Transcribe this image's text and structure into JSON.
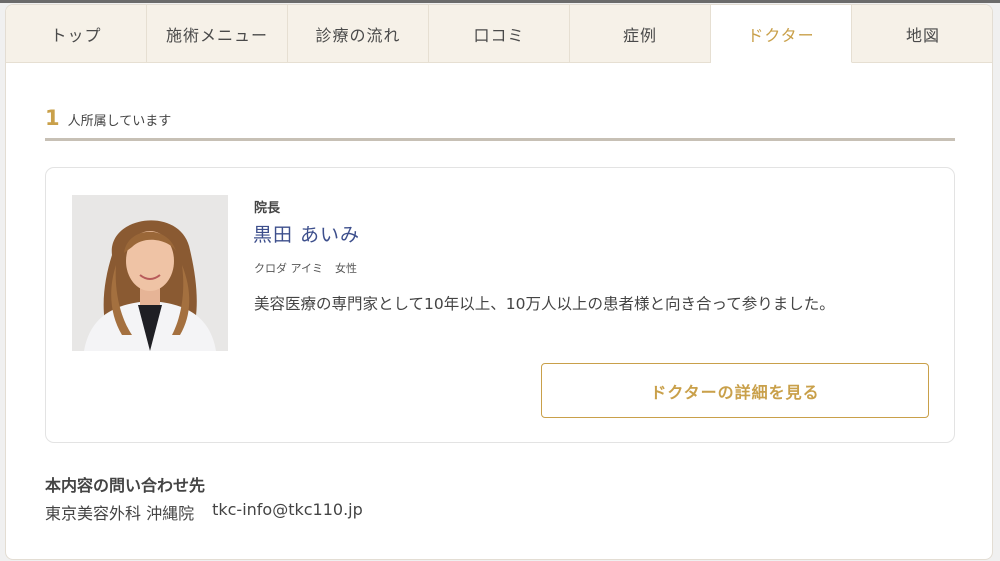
{
  "tabs": [
    {
      "label": "トップ",
      "active": false
    },
    {
      "label": "施術メニュー",
      "active": false
    },
    {
      "label": "診療の流れ",
      "active": false
    },
    {
      "label": "口コミ",
      "active": false
    },
    {
      "label": "症例",
      "active": false
    },
    {
      "label": "ドクター",
      "active": true
    },
    {
      "label": "地図",
      "active": false
    }
  ],
  "count": {
    "number": "1",
    "suffix": "人所属しています"
  },
  "doctor": {
    "role": "院長",
    "name": "黒田 あいみ",
    "kana": "クロダ アイミ",
    "gender": "女性",
    "description": "美容医療の専門家として10年以上、10万人以上の患者様と向き合って参りました。",
    "detail_button": "ドクターの詳細を見る",
    "photo_icon": "doctor-portrait"
  },
  "contact": {
    "title": "本内容の問い合わせ先",
    "clinic": "東京美容外科 沖縄院",
    "email": "tkc-info@tkc110.jp"
  },
  "colors": {
    "accent": "#c9a04a",
    "name": "#3d4f8c",
    "tab_bg": "#f6f1e8"
  }
}
